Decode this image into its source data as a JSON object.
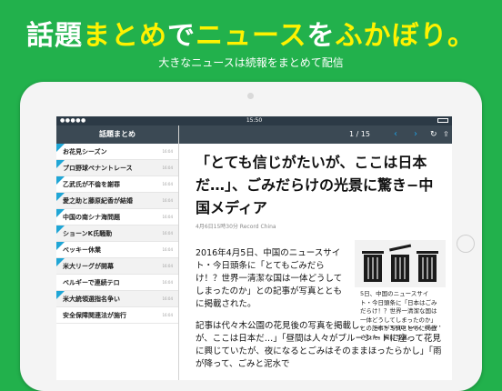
{
  "promo": {
    "headline_part1": "話題",
    "headline_part2": "まとめ",
    "headline_part3": "で",
    "headline_part4": "ニュース",
    "headline_part5": "を",
    "headline_part6": "ふかぼり。",
    "subline": "大きなニュースは続報をまとめて配信"
  },
  "status_bar": {
    "time": "15:50"
  },
  "sidebar": {
    "title": "話題まとめ",
    "items": [
      {
        "label": "お花見シーズン",
        "date": "16:04",
        "new": true
      },
      {
        "label": "プロ野球ペナントレース",
        "date": "16:04",
        "new": true
      },
      {
        "label": "乙武氏が不倫を謝罪",
        "date": "16:04",
        "new": true
      },
      {
        "label": "愛之助と藤原紀香が結婚",
        "date": "16:04",
        "new": true
      },
      {
        "label": "中国の南シナ海問題",
        "date": "16:04",
        "new": true
      },
      {
        "label": "ショーンK氏騒動",
        "date": "16:04",
        "new": true
      },
      {
        "label": "ベッキー休業",
        "date": "16:04",
        "new": true
      },
      {
        "label": "米大リーグが開幕",
        "date": "16:04",
        "new": true
      },
      {
        "label": "ベルギーで連続テロ",
        "date": "16:04",
        "new": false
      },
      {
        "label": "米大統領選指名争い",
        "date": "16:04",
        "new": true
      },
      {
        "label": "安全保障関連法が施行",
        "date": "16:04",
        "new": false
      }
    ]
  },
  "article_bar": {
    "pager": "1 / 15"
  },
  "article": {
    "title": "「とても信じがたいが、ここは日本だ…」、ごみだらけの光景に驚き−中国メディア",
    "meta": "4月6日15時30分 Record China",
    "paragraph1": "2016年4月5日、中国のニュースサイト・今日頭条に「とてもごみだらけ！？世界一清潔な国は一体どうしてしまったのか」との記事が写真とともに掲載された。",
    "paragraph2": "記事は代々木公園の花見後の写真を掲載し、「とても信じがたいが、ここは日本だ…」「昼間は人々がブルーシートに座って花見に興じていたが、夜になるとごみはそのままほったらかし」「雨が降って、ごみと泥水で",
    "figure_caption": "5日、中国のニュースサイト・今日頭条に「日本はごみだらけ！？世界一清潔な国は一体どうしてしまったのか」との記事が写真とともに掲載された。資料写真。"
  },
  "colors": {
    "background": "#22b14c",
    "headline_accent": "#fff200",
    "toolbar": "#3b4954",
    "ribbon": "#20a6d6",
    "nav_icon": "#1f9ee0"
  },
  "icons": {
    "prev": "chevron-left-icon",
    "next": "chevron-right-icon",
    "refresh": "refresh-icon",
    "share": "share-icon",
    "trash": "trash-can-icon"
  }
}
